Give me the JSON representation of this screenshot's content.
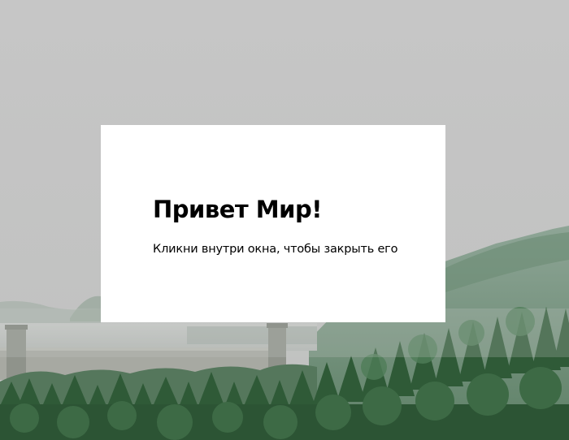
{
  "modal": {
    "title": "Привет Мир!",
    "message": "Кликни внутри окна, чтобы закрыть его"
  },
  "colors": {
    "modal_background": "#ffffff",
    "page_background": "#c5c5c5",
    "forest": "#3f6a45"
  }
}
